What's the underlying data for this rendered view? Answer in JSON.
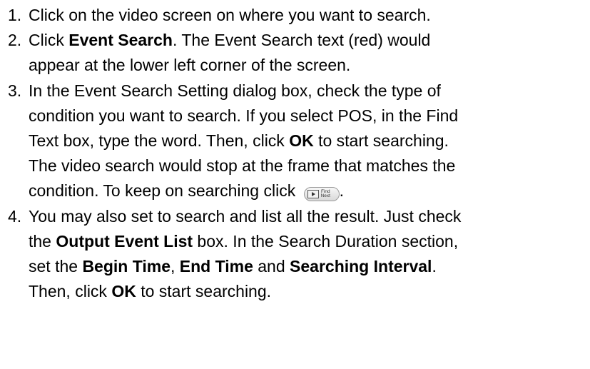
{
  "steps": [
    {
      "num": "1.",
      "line1": "Click on the video screen on where you want to search."
    },
    {
      "num": "2.",
      "t1": "Click ",
      "b1": "Event Search",
      "t2": ". The Event Search text (red) would",
      "line2": "appear at the lower left corner of the screen."
    },
    {
      "num": "3.",
      "line1": "In the Event Search Setting dialog box, check the type of",
      "line2": "condition you want to search. If you select POS, in the Find",
      "l3a": "Text box, type the word. Then, click ",
      "l3b": "OK",
      "l3c": " to start searching.",
      "line4": "The video search would stop at the frame that matches the",
      "line5": "condition. To keep on searching click ",
      "line5_end": ".",
      "button": {
        "icon": "find-next-icon",
        "text_top": "Find",
        "text_bottom": "Next"
      }
    },
    {
      "num": "4.",
      "line1": "You may also set to search and list all the result. Just check",
      "l2a": "the ",
      "l2b": "Output Event List",
      "l2c": " box. In the Search Duration section,",
      "l3a": "set the ",
      "l3b": "Begin Time",
      "l3c": ", ",
      "l3d": "End Time",
      "l3e": " and ",
      "l3f": "Searching Interval",
      "l3g": ".",
      "l4a": "Then, click ",
      "l4b": "OK",
      "l4c": " to start searching."
    }
  ]
}
